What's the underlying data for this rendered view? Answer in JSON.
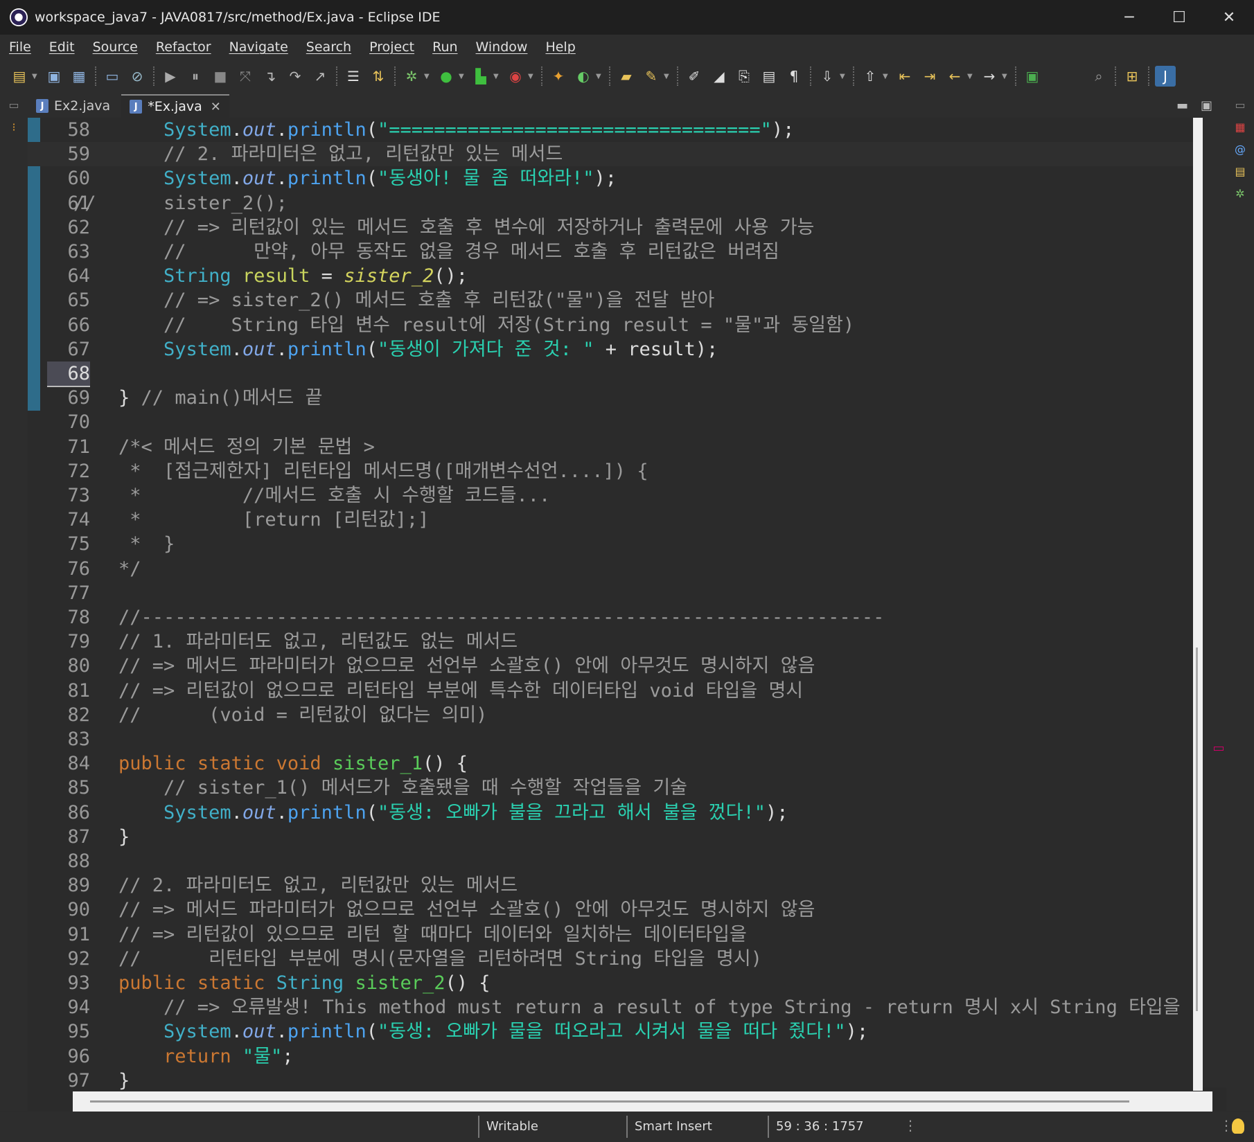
{
  "window": {
    "title": "workspace_java7 - JAVA0817/src/method/Ex.java - Eclipse IDE",
    "minimize": "─",
    "maximize": "☐",
    "close": "✕"
  },
  "menu": [
    "File",
    "Edit",
    "Source",
    "Refactor",
    "Navigate",
    "Search",
    "Project",
    "Run",
    "Window",
    "Help"
  ],
  "tabs": [
    {
      "label": "Ex2.java",
      "active": false
    },
    {
      "label": "*Ex.java",
      "active": true
    }
  ],
  "editor": {
    "lines": [
      {
        "n": "58",
        "tokens": [
          [
            "pl",
            "        "
          ],
          [
            "ty",
            "System"
          ],
          [
            "pl",
            "."
          ],
          [
            "out",
            "out"
          ],
          [
            "pl",
            "."
          ],
          [
            "mn",
            "println"
          ],
          [
            "pl",
            "("
          ],
          [
            "st",
            "\"=================================\""
          ],
          [
            "pl",
            ");"
          ]
        ]
      },
      {
        "n": "59",
        "current": true,
        "tokens": [
          [
            "cm",
            "        // 2. 파라미터은 없고, 리턴값만 있는 메서드"
          ]
        ]
      },
      {
        "n": "60",
        "tokens": [
          [
            "pl",
            "        "
          ],
          [
            "ty",
            "System"
          ],
          [
            "pl",
            "."
          ],
          [
            "out",
            "out"
          ],
          [
            "pl",
            "."
          ],
          [
            "mn",
            "println"
          ],
          [
            "pl",
            "("
          ],
          [
            "st",
            "\"동생아! 물 좀 떠와라!\""
          ],
          [
            "pl",
            ");"
          ]
        ]
      },
      {
        "n": "61",
        "tokens": [
          [
            "cm",
            "//      sister_2();"
          ]
        ]
      },
      {
        "n": "62",
        "tokens": [
          [
            "cm",
            "        // => 리턴값이 있는 메서드 호출 후 변수에 저장하거나 출력문에 사용 가능"
          ]
        ]
      },
      {
        "n": "63",
        "tokens": [
          [
            "cm",
            "        //      만약, 아무 동작도 없을 경우 메서드 호출 후 리턴값은 버려짐"
          ]
        ]
      },
      {
        "n": "64",
        "tokens": [
          [
            "pl",
            "        "
          ],
          [
            "ty",
            "String"
          ],
          [
            "pl",
            " "
          ],
          [
            "id",
            "result"
          ],
          [
            "pl",
            " = "
          ],
          [
            "it",
            "sister_2"
          ],
          [
            "pl",
            "();"
          ]
        ]
      },
      {
        "n": "65",
        "tokens": [
          [
            "cm",
            "        // => sister_2() 메서드 호출 후 리턴값(\"물\")을 전달 받아"
          ]
        ]
      },
      {
        "n": "66",
        "tokens": [
          [
            "cm",
            "        //    String 타입 변수 result에 저장(String result = \"물\"과 동일함)"
          ]
        ]
      },
      {
        "n": "67",
        "tokens": [
          [
            "pl",
            "        "
          ],
          [
            "ty",
            "System"
          ],
          [
            "pl",
            "."
          ],
          [
            "out",
            "out"
          ],
          [
            "pl",
            "."
          ],
          [
            "mn",
            "println"
          ],
          [
            "pl",
            "("
          ],
          [
            "st",
            "\"동생이 가져다 준 것: \""
          ],
          [
            "pl",
            " + result);"
          ]
        ]
      },
      {
        "n": "68",
        "hl": true,
        "tokens": [
          [
            "pl",
            ""
          ]
        ]
      },
      {
        "n": "69",
        "tokens": [
          [
            "pl",
            "    } "
          ],
          [
            "cm",
            "// main()메서드 끝"
          ]
        ]
      },
      {
        "n": "70",
        "tokens": [
          [
            "pl",
            ""
          ]
        ]
      },
      {
        "n": "71",
        "tokens": [
          [
            "cm",
            "    /*< 메서드 정의 기본 문법 >"
          ]
        ]
      },
      {
        "n": "72",
        "tokens": [
          [
            "cm",
            "     *  [접근제한자] 리턴타입 메서드명([매개변수선언....]) {"
          ]
        ]
      },
      {
        "n": "73",
        "tokens": [
          [
            "cm",
            "     *         //메서드 호출 시 수행할 코드들..."
          ]
        ]
      },
      {
        "n": "74",
        "tokens": [
          [
            "cm",
            "     *         [return [리턴값];]"
          ]
        ]
      },
      {
        "n": "75",
        "tokens": [
          [
            "cm",
            "     *  }"
          ]
        ]
      },
      {
        "n": "76",
        "tokens": [
          [
            "cm",
            "    */"
          ]
        ]
      },
      {
        "n": "77",
        "tokens": [
          [
            "pl",
            ""
          ]
        ]
      },
      {
        "n": "78",
        "tokens": [
          [
            "cm",
            "    //------------------------------------------------------------------"
          ]
        ]
      },
      {
        "n": "79",
        "tokens": [
          [
            "cm",
            "    // 1. 파라미터도 없고, 리턴값도 없는 메서드"
          ]
        ]
      },
      {
        "n": "80",
        "tokens": [
          [
            "cm",
            "    // => 메서드 파라미터가 없으므로 선언부 소괄호() 안에 아무것도 명시하지 않음"
          ]
        ]
      },
      {
        "n": "81",
        "tokens": [
          [
            "cm",
            "    // => 리턴값이 없으므로 리턴타입 부분에 특수한 데이터타입 void 타입을 명시"
          ]
        ]
      },
      {
        "n": "82",
        "tokens": [
          [
            "cm",
            "    //      (void = 리턴값이 없다는 의미)"
          ]
        ]
      },
      {
        "n": "83",
        "tokens": [
          [
            "pl",
            ""
          ]
        ]
      },
      {
        "n": "84",
        "tokens": [
          [
            "pl",
            "    "
          ],
          [
            "kw",
            "public"
          ],
          [
            "pl",
            " "
          ],
          [
            "kw",
            "static"
          ],
          [
            "pl",
            " "
          ],
          [
            "kw",
            "void"
          ],
          [
            "pl",
            " "
          ],
          [
            "fn",
            "sister_1"
          ],
          [
            "pl",
            "() {"
          ]
        ]
      },
      {
        "n": "85",
        "tokens": [
          [
            "cm",
            "        // sister_1() 메서드가 호출됐을 때 수행할 작업들을 기술"
          ]
        ]
      },
      {
        "n": "86",
        "tokens": [
          [
            "pl",
            "        "
          ],
          [
            "ty",
            "System"
          ],
          [
            "pl",
            "."
          ],
          [
            "out",
            "out"
          ],
          [
            "pl",
            "."
          ],
          [
            "mn",
            "println"
          ],
          [
            "pl",
            "("
          ],
          [
            "st",
            "\"동생: 오빠가 불을 끄라고 해서 불을 껐다!\""
          ],
          [
            "pl",
            ");"
          ]
        ]
      },
      {
        "n": "87",
        "tokens": [
          [
            "pl",
            "    }"
          ]
        ]
      },
      {
        "n": "88",
        "tokens": [
          [
            "pl",
            ""
          ]
        ]
      },
      {
        "n": "89",
        "tokens": [
          [
            "cm",
            "    // 2. 파라미터도 없고, 리턴값만 있는 메서드"
          ]
        ]
      },
      {
        "n": "90",
        "tokens": [
          [
            "cm",
            "    // => 메서드 파라미터가 없으므로 선언부 소괄호() 안에 아무것도 명시하지 않음"
          ]
        ]
      },
      {
        "n": "91",
        "tokens": [
          [
            "cm",
            "    // => 리턴값이 있으므로 리턴 할 때마다 데이터와 일치하는 데이터타입을"
          ]
        ]
      },
      {
        "n": "92",
        "tokens": [
          [
            "cm",
            "    //      리턴타입 부분에 명시(문자열을 리턴하려면 String 타입을 명시)"
          ]
        ]
      },
      {
        "n": "93",
        "tokens": [
          [
            "pl",
            "    "
          ],
          [
            "kw",
            "public"
          ],
          [
            "pl",
            " "
          ],
          [
            "kw",
            "static"
          ],
          [
            "pl",
            " "
          ],
          [
            "ty",
            "String"
          ],
          [
            "pl",
            " "
          ],
          [
            "fn",
            "sister_2"
          ],
          [
            "pl",
            "() {"
          ]
        ]
      },
      {
        "n": "94",
        "tokens": [
          [
            "cm",
            "        // => 오류발생! This method must return a result of type String - return 명시 x시 String 타입을 리턴해야"
          ]
        ]
      },
      {
        "n": "95",
        "tokens": [
          [
            "pl",
            "        "
          ],
          [
            "ty",
            "System"
          ],
          [
            "pl",
            "."
          ],
          [
            "out",
            "out"
          ],
          [
            "pl",
            "."
          ],
          [
            "mn",
            "println"
          ],
          [
            "pl",
            "("
          ],
          [
            "st",
            "\"동생: 오빠가 물을 떠오라고 시켜서 물을 떠다 줬다!\""
          ],
          [
            "pl",
            ");"
          ]
        ]
      },
      {
        "n": "96",
        "tokens": [
          [
            "pl",
            "        "
          ],
          [
            "kw",
            "return"
          ],
          [
            "pl",
            " "
          ],
          [
            "st",
            "\"물\""
          ],
          [
            "pl",
            ";"
          ]
        ]
      },
      {
        "n": "97",
        "tokens": [
          [
            "pl",
            "    }"
          ]
        ]
      }
    ]
  },
  "status": {
    "writable": "Writable",
    "insert_mode": "Smart Insert",
    "position": "59 : 36 : 1757"
  }
}
